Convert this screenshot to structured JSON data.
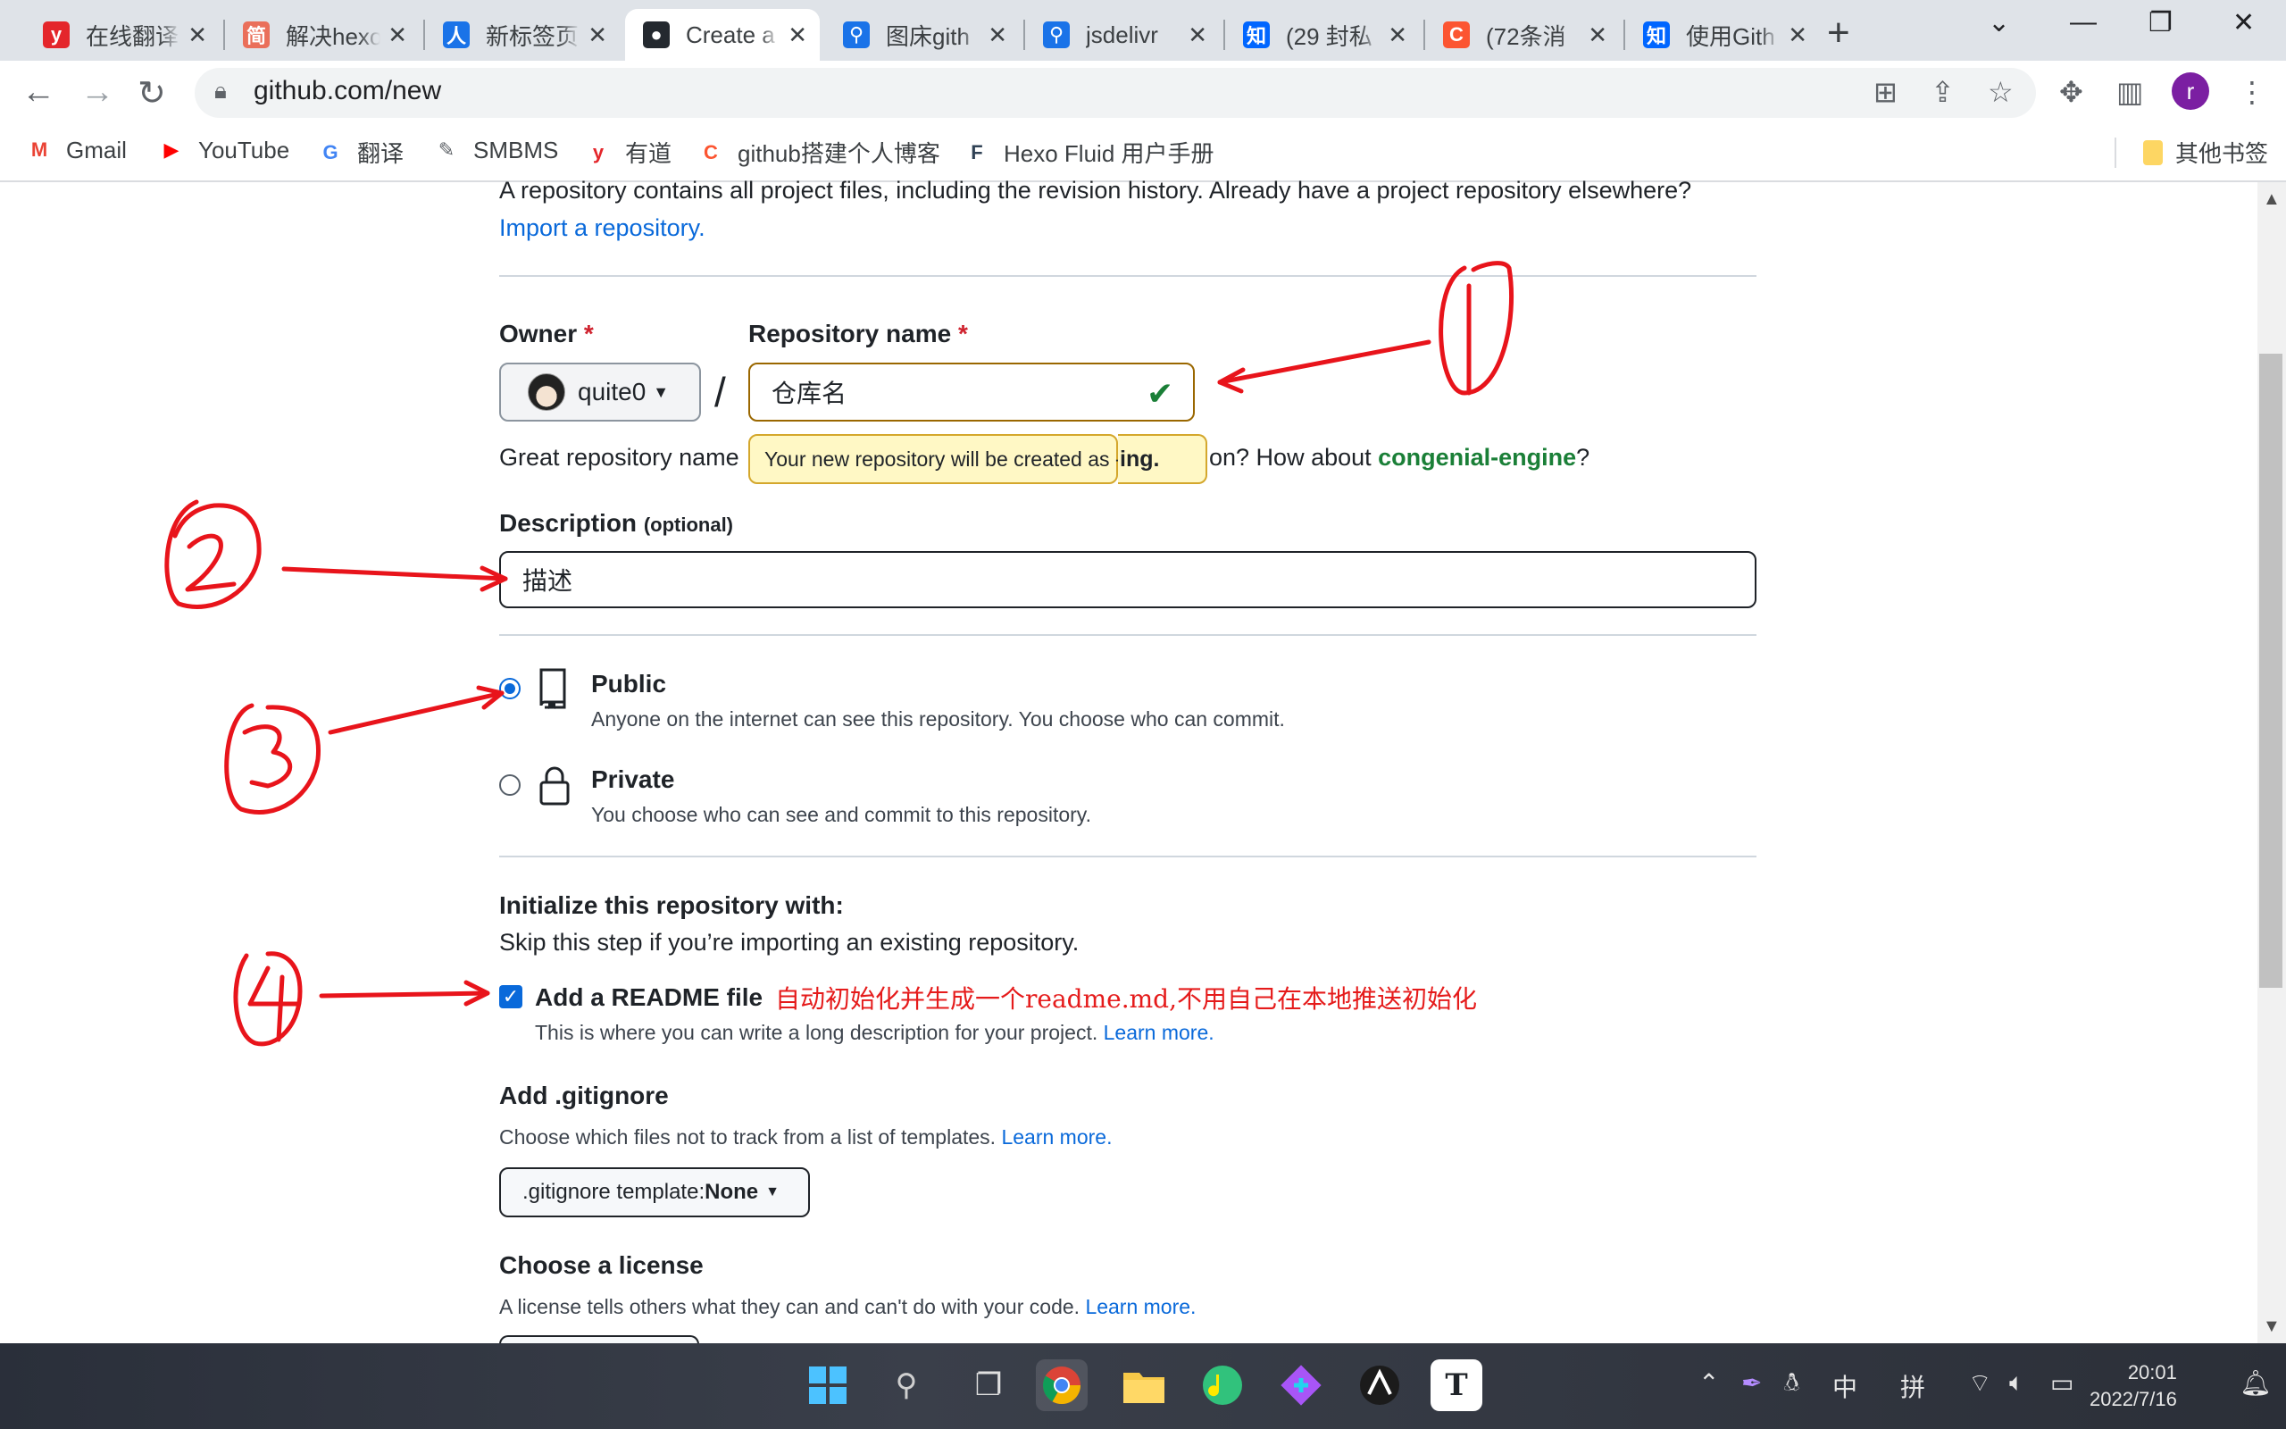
{
  "browser": {
    "tabs": [
      {
        "title": "在线翻译",
        "icon": "youdao-icon",
        "color": "#e4262b",
        "glyph": "y"
      },
      {
        "title": "解决hexo",
        "icon": "jianshu-icon",
        "color": "#ea6f5a",
        "glyph": "简"
      },
      {
        "title": "新标签页",
        "icon": "newtab-icon",
        "color": "#1a73e8",
        "glyph": "人"
      },
      {
        "title": "Create a",
        "icon": "github-icon",
        "color": "#24292f",
        "glyph": "●",
        "active": true
      },
      {
        "title": "图床gith",
        "icon": "search-icon",
        "color": "#1a73e8",
        "glyph": "⚲"
      },
      {
        "title": "jsdelivr",
        "icon": "search-icon",
        "color": "#1a73e8",
        "glyph": "⚲"
      },
      {
        "title": "(29 封私",
        "icon": "zhihu-icon",
        "color": "#0066ff",
        "glyph": "知"
      },
      {
        "title": "(72条消",
        "icon": "csdn-icon",
        "color": "#fc5531",
        "glyph": "C"
      },
      {
        "title": "使用Gith",
        "icon": "zhihu-icon",
        "color": "#0066ff",
        "glyph": "知"
      }
    ],
    "url": "github.com/new",
    "profile_initial": "r",
    "bookmarks": [
      {
        "label": "Gmail",
        "icon": "gmail-icon",
        "glyph": "M",
        "color": "#ea4335"
      },
      {
        "label": "YouTube",
        "icon": "youtube-icon",
        "glyph": "▶",
        "color": "#ff0000"
      },
      {
        "label": "翻译",
        "icon": "translate-icon",
        "glyph": "G",
        "color": "#4285f4"
      },
      {
        "label": "SMBMS",
        "icon": "smbms-icon",
        "glyph": "✎",
        "color": "#5f6368"
      },
      {
        "label": "有道",
        "icon": "youdao-icon",
        "glyph": "y",
        "color": "#e4262b"
      },
      {
        "label": "github搭建个人博客",
        "icon": "csdn-icon",
        "glyph": "C",
        "color": "#fc5531"
      },
      {
        "label": "Hexo Fluid 用户手册",
        "icon": "fluid-icon",
        "glyph": "F",
        "color": "#2f4154"
      }
    ],
    "other_bookmarks": "其他书签"
  },
  "page": {
    "intro_text": "A repository contains all project files, including the revision history. Already have a project repository elsewhere?",
    "import_link": "Import a repository.",
    "owner_label": "Owner",
    "required_mark": "*",
    "owner_value": "quite0",
    "slash": "/",
    "repo_label": "Repository name",
    "repo_value": "仓库名",
    "tooltip_text": "Your new repository will be created as -.",
    "tooltip_tail": "ing.",
    "name_hint_start": "Great repository name",
    "name_hint_mid": "on? How about ",
    "name_suggestion": "congenial-engine",
    "name_hint_end": "?",
    "description_label": "Description",
    "description_optional": "(optional)",
    "description_value": "描述",
    "public_label": "Public",
    "public_desc": "Anyone on the internet can see this repository. You choose who can commit.",
    "private_label": "Private",
    "private_desc": "You choose who can see and commit to this repository.",
    "init_title": "Initialize this repository with:",
    "init_desc": "Skip this step if you’re importing an existing repository.",
    "readme_label": "Add a README file",
    "readme_desc": "This is where you can write a long description for your project.",
    "learn_more": "Learn more.",
    "readme_note": "自动初始化并生成一个readme.md,不用自己在本地推送初始化",
    "gitignore_title": "Add .gitignore",
    "gitignore_desc": "Choose which files not to track from a list of templates.",
    "gitignore_btn_prefix": ".gitignore template: ",
    "gitignore_btn_value": "None",
    "license_title": "Choose a license",
    "license_desc": "A license tells others what they can and can't do with your code."
  },
  "taskbar": {
    "apps": [
      "windows-start-icon",
      "search-icon",
      "task-view-icon",
      "chrome-icon",
      "file-explorer-icon",
      "music-icon",
      "git-icon",
      "game-icon",
      "typora-icon"
    ],
    "ime_lang": "中",
    "ime_mode": "拼",
    "time": "20:01",
    "date": "2022/7/16"
  }
}
